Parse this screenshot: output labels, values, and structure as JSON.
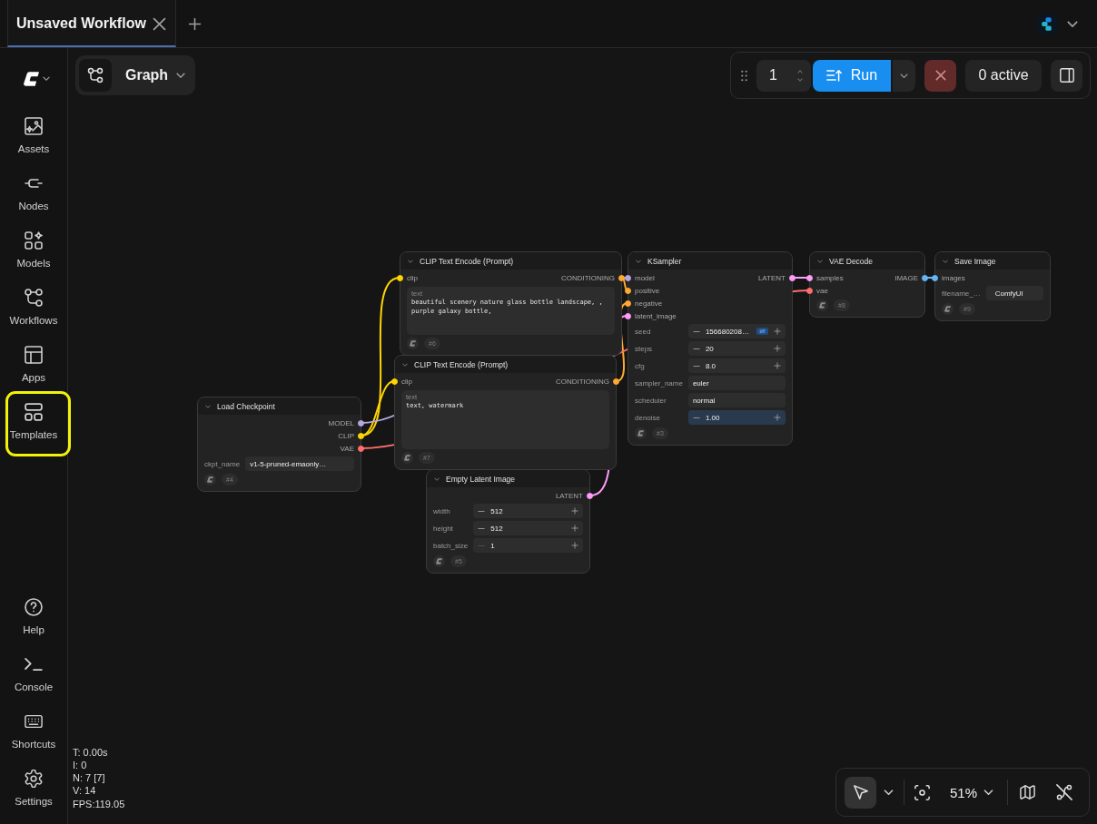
{
  "tabs": [
    {
      "label": "Unsaved Workflow",
      "selected": true
    }
  ],
  "sidebar": {
    "items": [
      {
        "label": "Assets",
        "selected": false,
        "highlighted": false
      },
      {
        "label": "Nodes",
        "selected": false,
        "highlighted": false
      },
      {
        "label": "Models",
        "selected": false,
        "highlighted": false
      },
      {
        "label": "Workflows",
        "selected": false,
        "highlighted": false
      },
      {
        "label": "Apps",
        "selected": false,
        "highlighted": false
      },
      {
        "label": "Templates",
        "selected": false,
        "highlighted": true
      }
    ],
    "bottom_items": [
      {
        "label": "Help",
        "selected": false,
        "highlighted": false
      },
      {
        "label": "Console",
        "selected": false,
        "highlighted": false
      },
      {
        "label": "Shortcuts",
        "selected": false,
        "highlighted": false
      },
      {
        "label": "Settings",
        "selected": false,
        "highlighted": false
      }
    ]
  },
  "view_mode": {
    "label": "Graph"
  },
  "run_toolbar": {
    "batch_count": "1",
    "run_label": "Run",
    "queue_status": "0 active"
  },
  "nodes": [
    {
      "title": "Load Checkpoint",
      "badge": "#4",
      "outputs": [
        {
          "label": "MODEL",
          "color": "#b4a7e0"
        },
        {
          "label": "CLIP",
          "color": "#ffd500"
        },
        {
          "label": "VAE",
          "color": "#ff6e6e"
        }
      ],
      "widgets": [
        {
          "kind": "combo",
          "label": "ckpt_name",
          "value": "v1-5-pruned-emaonly…",
          "focused": false
        }
      ]
    },
    {
      "title": "CLIP Text Encode (Prompt)",
      "badge": "#6",
      "inputs": [
        {
          "label": "clip",
          "color": "#ffd500",
          "linked": true
        }
      ],
      "outputs": [
        {
          "label": "CONDITIONING",
          "color": "#ffa931"
        }
      ],
      "widgets": [
        {
          "kind": "text",
          "label": "text",
          "value": "beautiful scenery nature glass bottle landscape, , purple galaxy bottle,",
          "focused": false
        }
      ]
    },
    {
      "title": "CLIP Text Encode (Prompt)",
      "badge": "#7",
      "inputs": [
        {
          "label": "clip",
          "color": "#ffd500",
          "linked": true
        }
      ],
      "outputs": [
        {
          "label": "CONDITIONING",
          "color": "#ffa931"
        }
      ],
      "widgets": [
        {
          "kind": "text",
          "label": "text",
          "value": "text, watermark",
          "focused": false
        }
      ]
    },
    {
      "title": "Empty Latent Image",
      "badge": "#5",
      "outputs": [
        {
          "label": "LATENT",
          "color": "#ff9cf9"
        }
      ],
      "widgets": [
        {
          "kind": "number",
          "label": "width",
          "value": "512",
          "focused": false,
          "decrement_disabled": false,
          "mode_badge": false
        },
        {
          "kind": "number",
          "label": "height",
          "value": "512",
          "focused": false,
          "decrement_disabled": false,
          "mode_badge": false
        },
        {
          "kind": "number",
          "label": "batch_size",
          "value": "1",
          "focused": false,
          "decrement_disabled": true,
          "mode_badge": false
        }
      ]
    },
    {
      "title": "KSampler",
      "badge": "#3",
      "inputs": [
        {
          "label": "model",
          "color": "#b4a7e0",
          "linked": true
        },
        {
          "label": "positive",
          "color": "#ffa931",
          "linked": true
        },
        {
          "label": "negative",
          "color": "#ffa931",
          "linked": true
        },
        {
          "label": "latent_image",
          "color": "#ff9cf9",
          "linked": true
        }
      ],
      "outputs": [
        {
          "label": "LATENT",
          "color": "#ff9cf9"
        }
      ],
      "widgets": [
        {
          "kind": "number",
          "label": "seed",
          "value": "156680208…",
          "focused": false,
          "decrement_disabled": false,
          "mode_badge": true
        },
        {
          "kind": "number",
          "label": "steps",
          "value": "20",
          "focused": false,
          "decrement_disabled": false,
          "mode_badge": false
        },
        {
          "kind": "number",
          "label": "cfg",
          "value": "8.0",
          "focused": false,
          "decrement_disabled": false,
          "mode_badge": false
        },
        {
          "kind": "combo",
          "label": "sampler_name",
          "value": "euler",
          "focused": false
        },
        {
          "kind": "combo",
          "label": "scheduler",
          "value": "normal",
          "focused": false
        },
        {
          "kind": "number",
          "label": "denoise",
          "value": "1.00",
          "focused": true,
          "decrement_disabled": false,
          "mode_badge": false
        }
      ]
    },
    {
      "title": "VAE Decode",
      "badge": "#8",
      "inputs": [
        {
          "label": "samples",
          "color": "#ff9cf9",
          "linked": true
        },
        {
          "label": "vae",
          "color": "#ff6e6e",
          "linked": true
        }
      ],
      "outputs": [
        {
          "label": "IMAGE",
          "color": "#64b5f6"
        }
      ]
    },
    {
      "title": "Save Image",
      "badge": "#9",
      "inputs": [
        {
          "label": "images",
          "color": "#64b5f6",
          "linked": true
        }
      ],
      "widgets": [
        {
          "kind": "string",
          "label": "filename_…",
          "value": "ComfyUI",
          "focused": false
        }
      ]
    }
  ],
  "stats": [
    "T: 0.00s",
    "I: 0",
    "N: 7 [7]",
    "V: 14",
    "FPS:119.05"
  ],
  "canvas_toolbar": {
    "pointer_selected": true,
    "zoom": "51%"
  }
}
